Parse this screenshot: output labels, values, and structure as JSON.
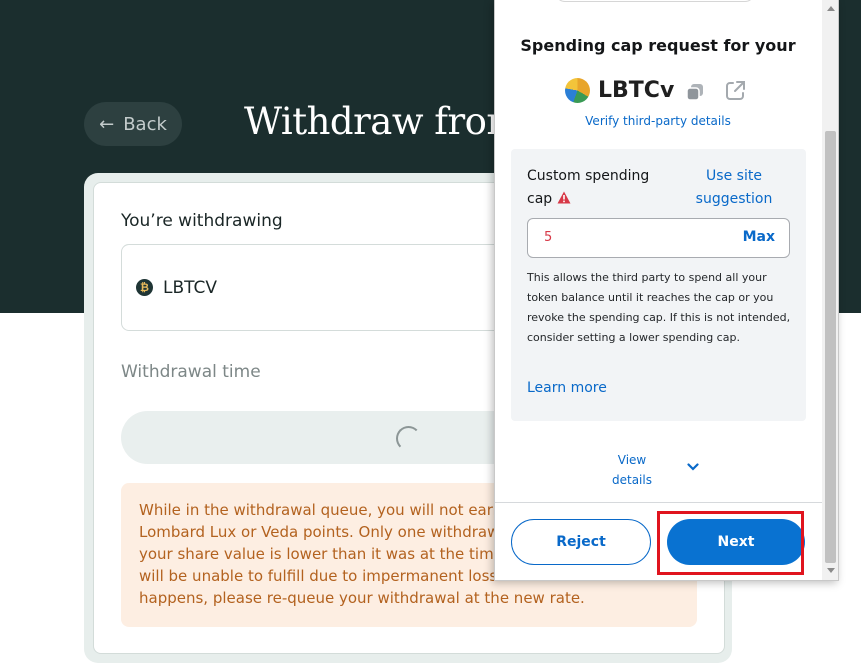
{
  "page": {
    "back_label": "Back",
    "title": "Withdraw from",
    "withdrawing_label": "You’re withdrawing",
    "token_icon_glyph": "₿",
    "token_name": "LBTCV",
    "withdrawal_time_label": "Withdrawal time",
    "notice_lines": [
      "While in the withdrawal queue, you will not earn po",
      "Lombard Lux or Veda points. Only one withdrawal r",
      "your share value is lower than it was at the time you",
      "will be unable to fulfill due to impermanent loss or r",
      "happens, please re-queue your withdrawal at the new rate."
    ]
  },
  "popup": {
    "title": "Spending cap request for your",
    "token": "LBTCv",
    "verify_link": "Verify third-party details",
    "custom_cap_label": "Custom spending cap",
    "site_suggestion": "Use site suggestion",
    "cap_value": "5",
    "max_label": "Max",
    "description": "This allows the third party to spend all your token balance until it reaches the cap or you revoke the spending cap. If this is not intended, consider setting a lower spending cap.",
    "learn_more": "Learn more",
    "view_details": "View details",
    "reject_label": "Reject",
    "next_label": "Next"
  },
  "colors": {
    "hero_bg": "#1b2e2e",
    "link_blue": "#0969c9",
    "primary_button": "#0972d1",
    "highlight_red": "#e0141e",
    "notice_text": "#b3621f",
    "notice_bg": "#fdeee2"
  },
  "icons": [
    "arrow-left-icon",
    "bitcoin-icon",
    "loading-spinner-icon",
    "token-logo-icon",
    "copy-icon",
    "external-link-icon",
    "warning-icon",
    "chevron-down-icon"
  ]
}
